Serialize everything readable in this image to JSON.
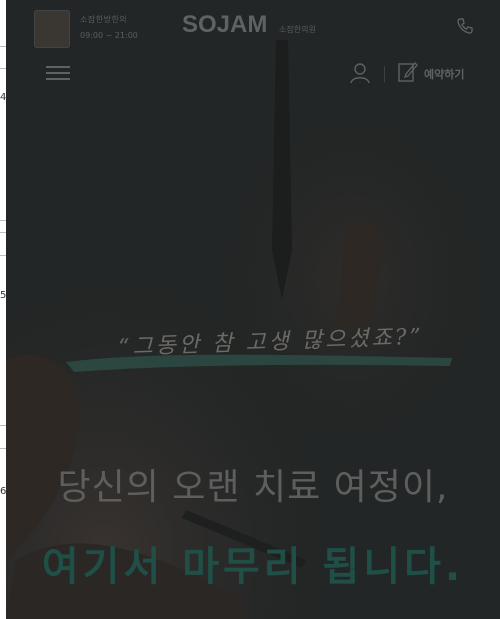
{
  "gutter": {
    "marks": [
      "4",
      "5",
      "6"
    ]
  },
  "header": {
    "clinic_name": "소잠한방한의",
    "clinic_hours": "09:00 ~ 21:00",
    "logo": "SOJAM",
    "logo_sub": "소잠한의원",
    "book_label": "예약하기"
  },
  "hero": {
    "quote": "“그동안 참 고생 많으셨죠?”",
    "headline_1": "당신의 오랜 치료 여정이,",
    "headline_2": "여기서 마무리 됩니다."
  },
  "colors": {
    "overlay": "#232626",
    "accent": "#1f4f46",
    "brush": "#2c4a44"
  },
  "icons": [
    "phone-icon",
    "menu-icon",
    "user-icon",
    "book-icon"
  ]
}
